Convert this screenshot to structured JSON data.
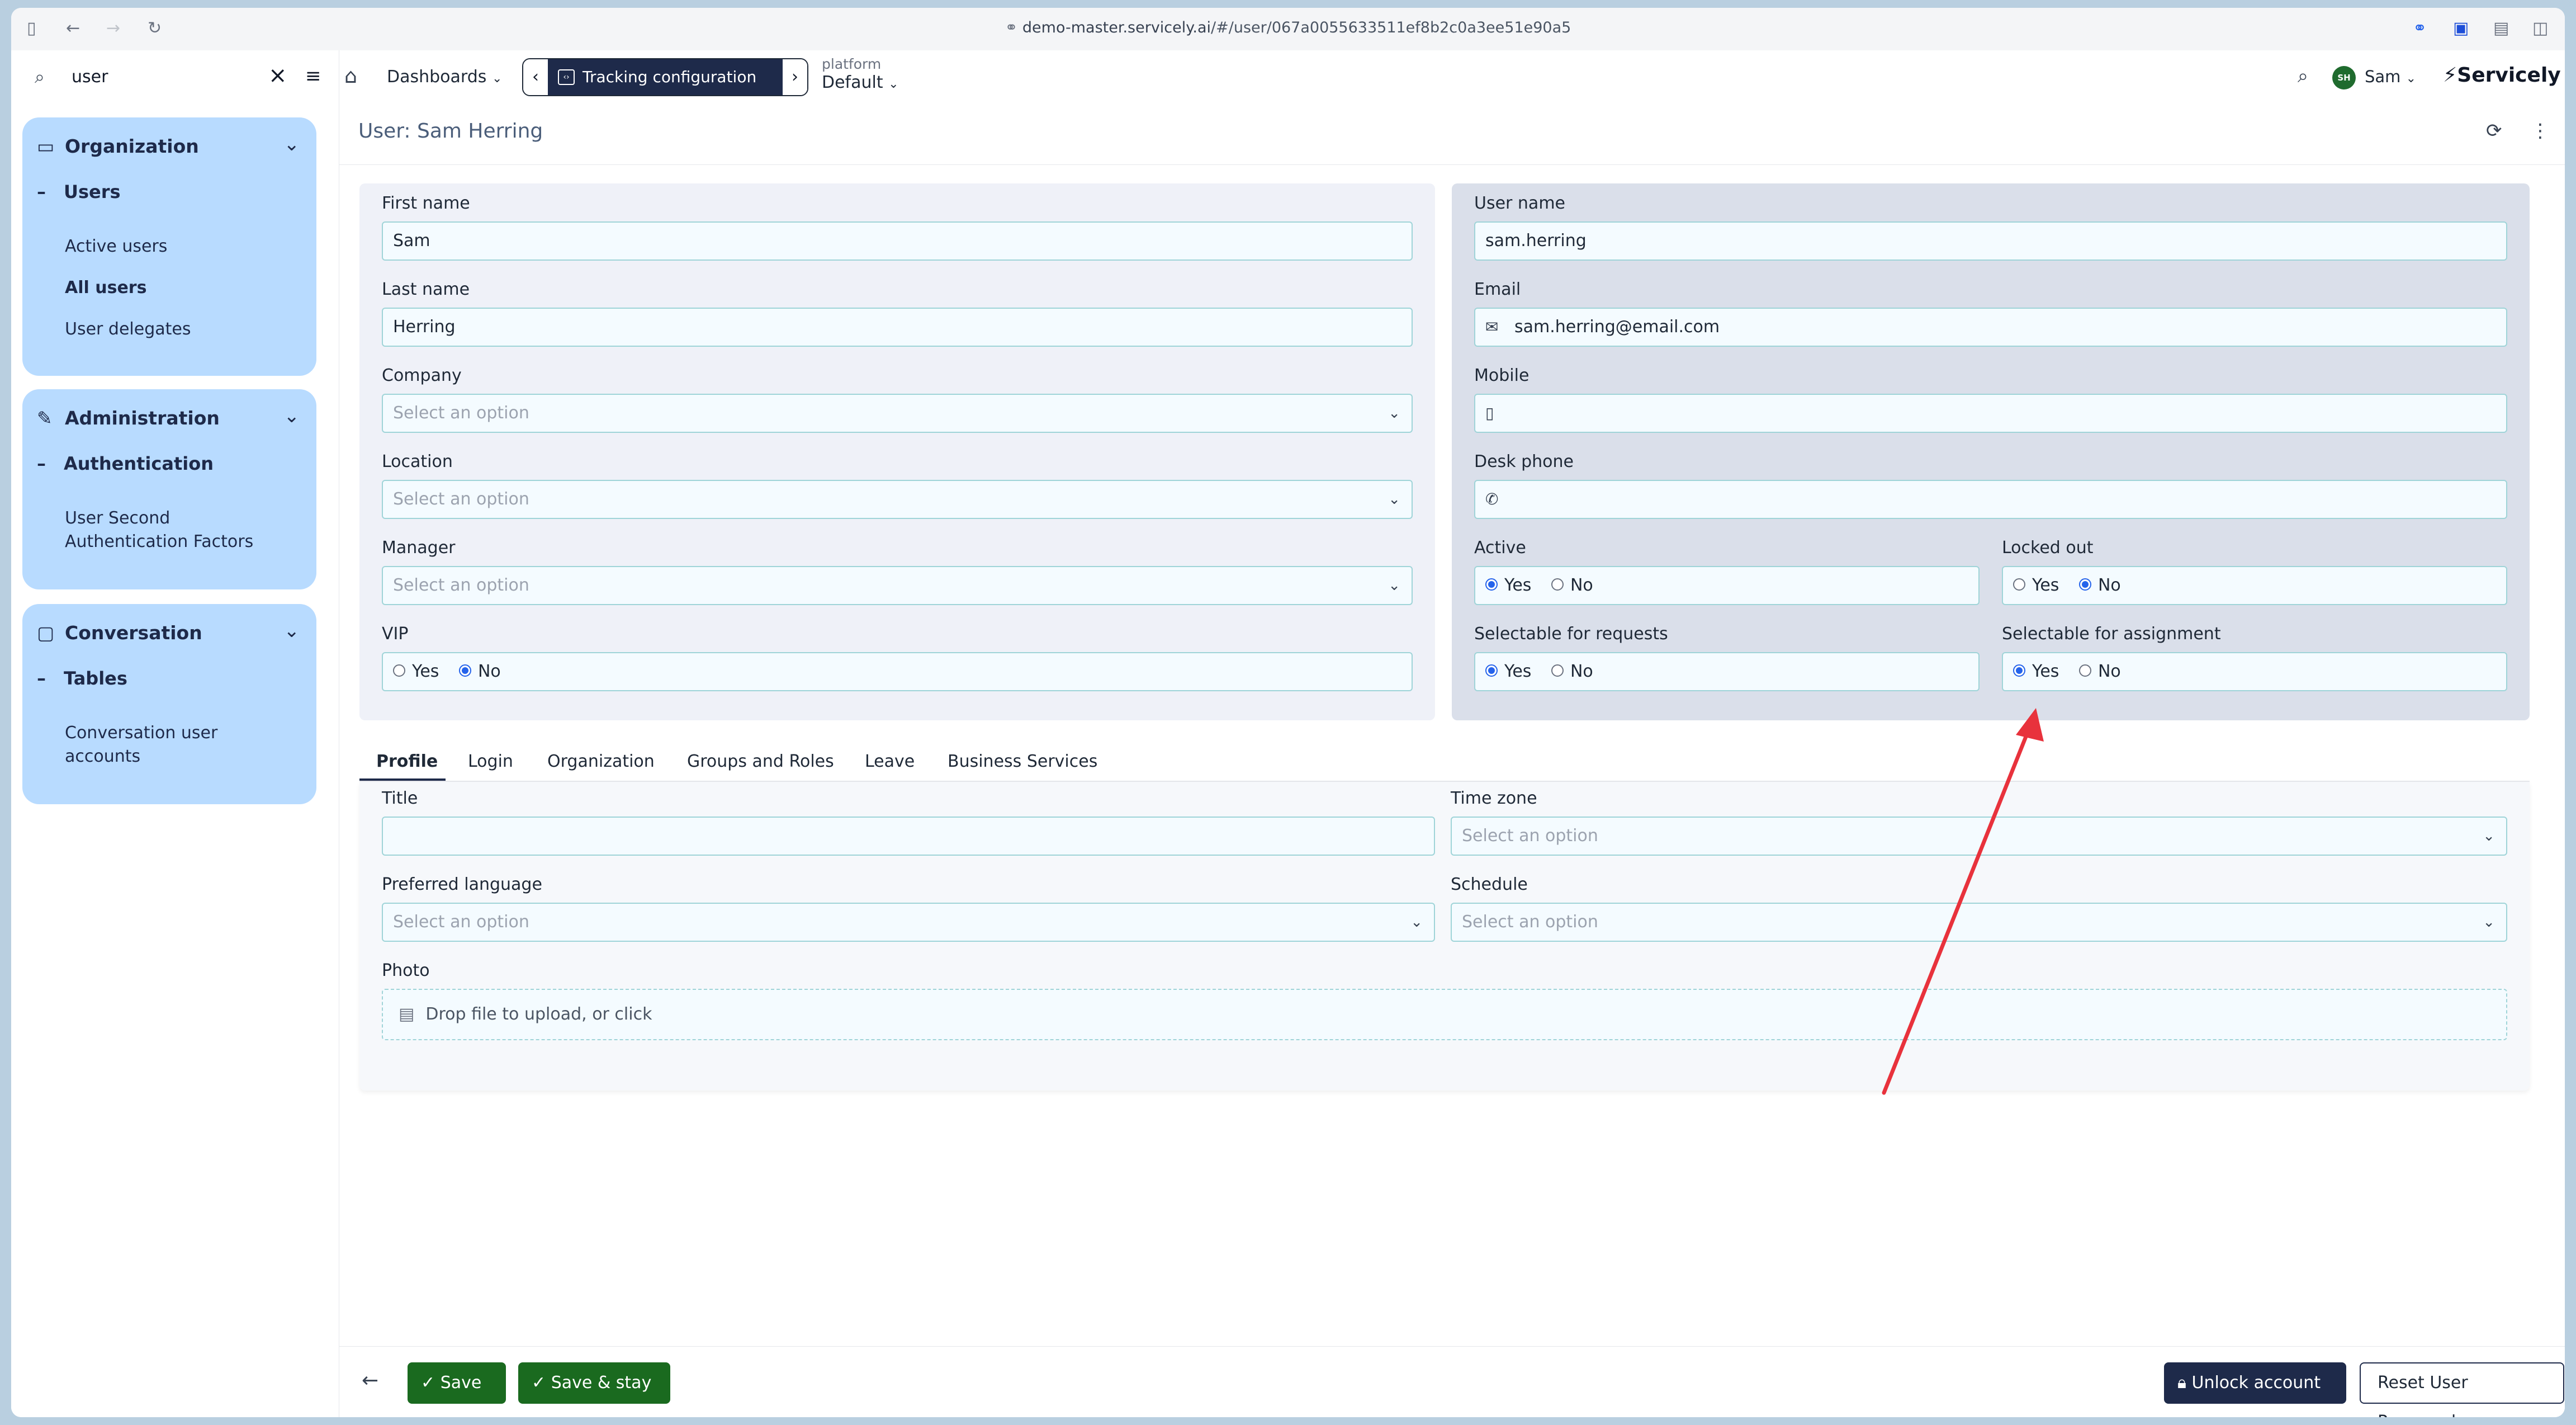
{
  "browser": {
    "url_host": "demo-master.servicely.ai",
    "url_path": "/#/user/067a0055633511ef8b2c0a3ee51e90a5"
  },
  "header": {
    "search_value": "user",
    "dashboards_label": "Dashboards",
    "tracking_label": "Tracking configuration",
    "platform_label": "platform",
    "platform_value": "Default",
    "avatar_initials": "SH",
    "user_name": "Sam",
    "brand": "Servicely"
  },
  "sidebar": {
    "groups": [
      {
        "title": "Organization",
        "section": "Users",
        "items": [
          "Active users",
          "All users",
          "User delegates"
        ]
      },
      {
        "title": "Administration",
        "section": "Authentication",
        "items": [
          "User Second Authentication Factors"
        ]
      },
      {
        "title": "Conversation",
        "section": "Tables",
        "items": [
          "Conversation user accounts"
        ]
      }
    ]
  },
  "page": {
    "title": "User: Sam Herring"
  },
  "form": {
    "placeholder": "Select an option",
    "first_name_label": "First name",
    "first_name": "Sam",
    "last_name_label": "Last name",
    "last_name": "Herring",
    "company_label": "Company",
    "location_label": "Location",
    "manager_label": "Manager",
    "vip_label": "VIP",
    "user_name_label": "User name",
    "user_name": "sam.herring",
    "email_label": "Email",
    "email": "sam.herring@email.com",
    "mobile_label": "Mobile",
    "desk_phone_label": "Desk phone",
    "active_label": "Active",
    "locked_out_label": "Locked out",
    "selectable_requests_label": "Selectable for requests",
    "selectable_assignment_label": "Selectable for assignment",
    "yes": "Yes",
    "no": "No"
  },
  "tabs": [
    "Profile",
    "Login",
    "Organization",
    "Groups and Roles",
    "Leave",
    "Business Services"
  ],
  "profile": {
    "title_label": "Title",
    "time_zone_label": "Time zone",
    "preferred_language_label": "Preferred language",
    "schedule_label": "Schedule",
    "photo_label": "Photo",
    "dropzone_text": "Drop file to upload, or click"
  },
  "footer": {
    "save": "Save",
    "save_stay": "Save & stay",
    "unlock": "Unlock account",
    "reset_password": "Reset User Password"
  },
  "colors": {
    "accent": "#1e2a4a",
    "save_green": "#1a6a1f",
    "nav_bg": "#b8dbff",
    "annotation_red": "#e8323c"
  }
}
